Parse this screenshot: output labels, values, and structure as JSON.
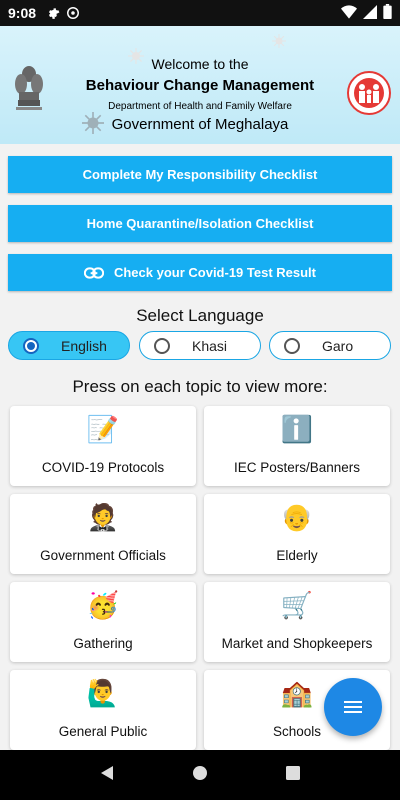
{
  "status": {
    "time": "9:08",
    "left_icons": [
      "gear-icon",
      "at-sign-icon"
    ],
    "right_icons": [
      "wifi-icon",
      "signal-icon",
      "battery-icon"
    ]
  },
  "header": {
    "line1": "Welcome to the",
    "line2": "Behaviour Change Management",
    "line3": "Department of Health and Family Welfare",
    "line4": "Government of Meghalaya",
    "background_color": "#cdeef9"
  },
  "actions": [
    {
      "label": "Complete My Responsibility Checklist"
    },
    {
      "label": "Home Quarantine/Isolation Checklist"
    },
    {
      "label": "Check your Covid-19 Test Result",
      "icon": "link-icon"
    }
  ],
  "language": {
    "title": "Select Language",
    "options": [
      {
        "label": "English",
        "selected": true
      },
      {
        "label": "Khasi",
        "selected": false
      },
      {
        "label": "Garo",
        "selected": false
      }
    ]
  },
  "topics": {
    "title": "Press on each topic to view more:",
    "items": [
      {
        "label": "COVID-19 Protocols",
        "emoji": "📝"
      },
      {
        "label": "IEC Posters/Banners",
        "emoji": "ℹ️"
      },
      {
        "label": "Government Officials",
        "emoji": "🤵"
      },
      {
        "label": "Elderly",
        "emoji": "👴"
      },
      {
        "label": "Gathering",
        "emoji": "🥳"
      },
      {
        "label": "Market and Shopkeepers",
        "emoji": "🛒"
      },
      {
        "label": "General Public",
        "emoji": "🙋‍♂️"
      },
      {
        "label": "Schools",
        "emoji": "🏫"
      }
    ]
  },
  "fab": {
    "icon": "menu-icon"
  },
  "nav": {
    "icons": [
      "back-icon",
      "home-icon",
      "recents-icon"
    ]
  },
  "colors": {
    "accent": "#16aef2",
    "selected_lang": "#37c6f4",
    "fab": "#1e88e5"
  }
}
